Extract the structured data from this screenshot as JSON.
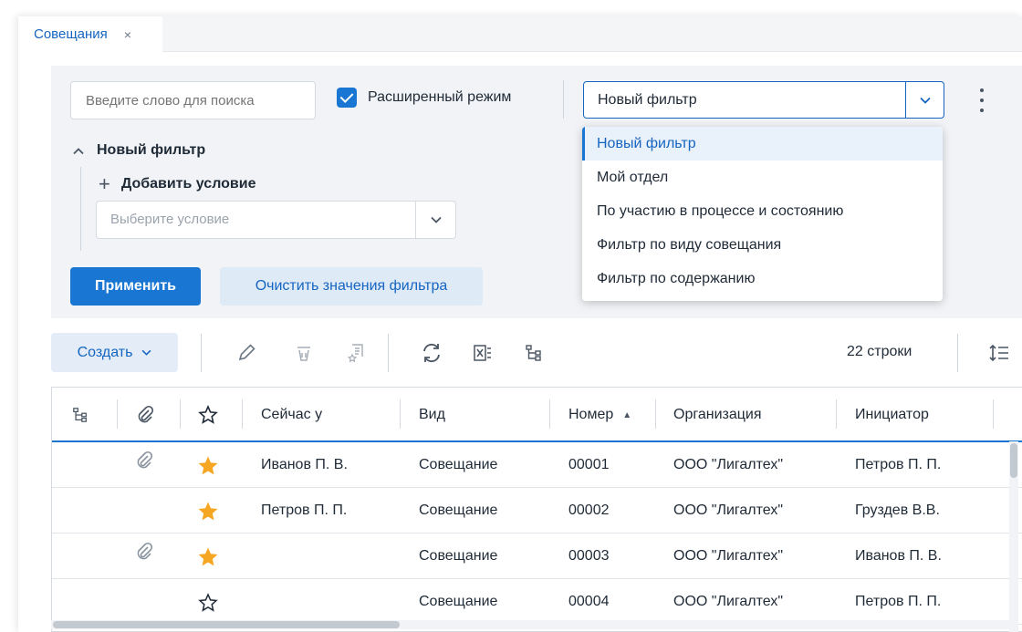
{
  "tab": {
    "title": "Совещания",
    "close": "×"
  },
  "filter": {
    "search_placeholder": "Введите слово для поиска",
    "advanced_mode_label": "Расширенный режим",
    "selected_filter": "Новый фильтр",
    "tree_title": "Новый фильтр",
    "add_condition_label": "Добавить условие",
    "condition_placeholder": "Выберите условие",
    "apply_label": "Применить",
    "clear_label": "Очистить значения фильтра",
    "options": [
      "Новый фильтр",
      "Мой отдел",
      "По участию в процессе и состоянию",
      "Фильтр по виду совещания",
      "Фильтр по содержанию"
    ]
  },
  "toolbar": {
    "create_label": "Создать",
    "row_count": "22 строки"
  },
  "table": {
    "columns": {
      "now_at": "Сейчас у",
      "kind": "Вид",
      "number": "Номер",
      "organization": "Организация",
      "initiator": "Инициатор"
    },
    "rows": [
      {
        "attach": true,
        "star": true,
        "now_at": "Иванов П. В.",
        "kind": "Совещание",
        "number": "00001",
        "organization": "ООО \"Лигалтех\"",
        "initiator": "Петров П. П."
      },
      {
        "attach": false,
        "star": true,
        "now_at": "Петров П. П.",
        "kind": "Совещание",
        "number": "00002",
        "organization": "ООО \"Лигалтех\"",
        "initiator": "Груздев В.В."
      },
      {
        "attach": true,
        "star": true,
        "now_at": "",
        "kind": "Совещание",
        "number": "00003",
        "organization": "ООО \"Лигалтех\"",
        "initiator": "Иванов П. В."
      },
      {
        "attach": false,
        "star": false,
        "now_at": "",
        "kind": "Совещание",
        "number": "00004",
        "organization": "ООО \"Лигалтех\"",
        "initiator": "Петров П. П."
      }
    ]
  },
  "colors": {
    "accent": "#1976d2",
    "star": "#f5a623"
  }
}
